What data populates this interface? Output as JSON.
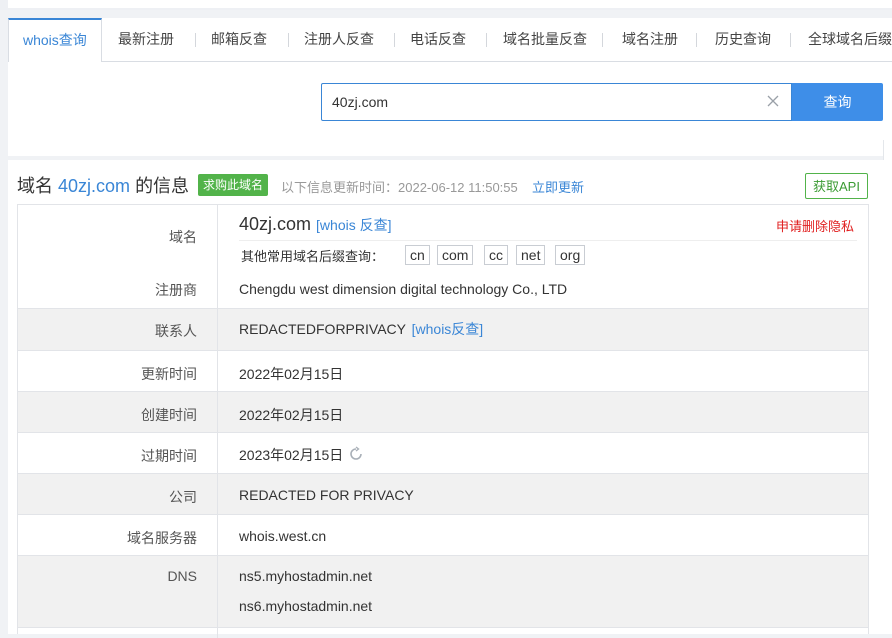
{
  "nav": {
    "tabs": [
      {
        "label": "whois查询",
        "active": true
      },
      {
        "label": "最新注册"
      },
      {
        "label": "邮箱反查"
      },
      {
        "label": "注册人反查"
      },
      {
        "label": "电话反查"
      },
      {
        "label": "域名批量反查"
      },
      {
        "label": "域名注册"
      },
      {
        "label": "历史查询"
      },
      {
        "label": "全球域名后缀"
      }
    ]
  },
  "search": {
    "value": "40zj.com",
    "button_label": "查询"
  },
  "info": {
    "title_prefix": "域名",
    "domain": "40zj.com",
    "title_suffix": "的信息",
    "buy_label": "求购此域名",
    "updated_text": "以下信息更新时间：2022-06-12 11:50:55",
    "update_now_label": "立即更新",
    "api_label": "获取API"
  },
  "record": {
    "domain_label": "域名",
    "domain_value": "40zj.com",
    "domain_whois_link": "[whois 反查]",
    "privacy_label": "申请删除隐私",
    "suffix_label": "其他常用域名后缀查询：",
    "suffixes": [
      "cn",
      "com",
      "cc",
      "net",
      "org"
    ],
    "registrar_label": "注册商",
    "registrar_value": "Chengdu west dimension digital technology Co., LTD",
    "contact_label": "联系人",
    "contact_value": "REDACTEDFORPRIVACY",
    "contact_whois_link": "[whois反查]",
    "updated_label": "更新时间",
    "updated_value": "2022年02月15日",
    "created_label": "创建时间",
    "created_value": "2022年02月15日",
    "expires_label": "过期时间",
    "expires_value": "2023年02月15日",
    "company_label": "公司",
    "company_value": "REDACTED FOR PRIVACY",
    "server_label": "域名服务器",
    "server_value": "whois.west.cn",
    "dns_label": "DNS",
    "dns_values": [
      "ns5.myhostadmin.net",
      "ns6.myhostadmin.net"
    ]
  },
  "colors": {
    "accent": "#3a86d6",
    "button": "#3e8ee8",
    "green": "#52b34a",
    "danger": "#e02020"
  },
  "icons": [
    "clear-icon",
    "refresh-icon"
  ]
}
